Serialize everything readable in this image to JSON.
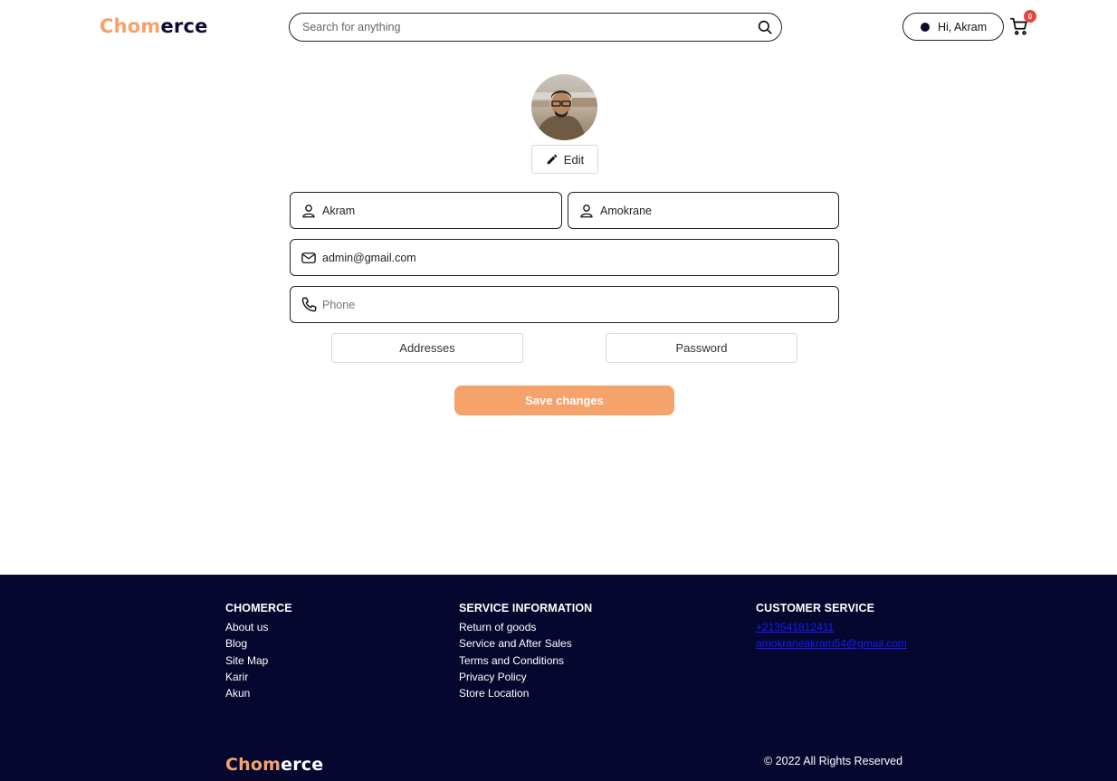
{
  "brand": {
    "part1": "Chom",
    "part2": "erce"
  },
  "header": {
    "search_placeholder": "Search for anything",
    "greeting": "Hi, Akram",
    "cart_count": "0"
  },
  "profile": {
    "edit_label": "Edit",
    "first_name": "Akram",
    "last_name": "Amokrane",
    "email": "admin@gmail.com",
    "phone_placeholder": "Phone",
    "addresses_label": "Addresses",
    "password_label": "Password",
    "save_label": "Save changes"
  },
  "footer": {
    "col1": {
      "title": "CHOMERCE",
      "links": [
        "About us",
        "Blog",
        "Site Map",
        "Karir",
        "Akun"
      ]
    },
    "col2": {
      "title": "SERVICE INFORMATION",
      "links": [
        "Return of goods",
        "Service and After Sales",
        "Terms and Conditions",
        "Privacy Policy",
        "Store Location"
      ]
    },
    "col3": {
      "title": "CUSTOMER SERVICE",
      "links": [
        "+213541812411",
        "amokraneakram54@gmail.com"
      ]
    },
    "copyright": "© 2022 All Rights Reserved"
  },
  "colors": {
    "accent": "#f5a26b",
    "navy": "#05072e",
    "badge": "#e8453c",
    "link": "#1a1aff"
  },
  "icons": [
    "search-icon",
    "user-icon",
    "mail-icon",
    "phone-icon",
    "pencil-icon",
    "cart-icon"
  ]
}
